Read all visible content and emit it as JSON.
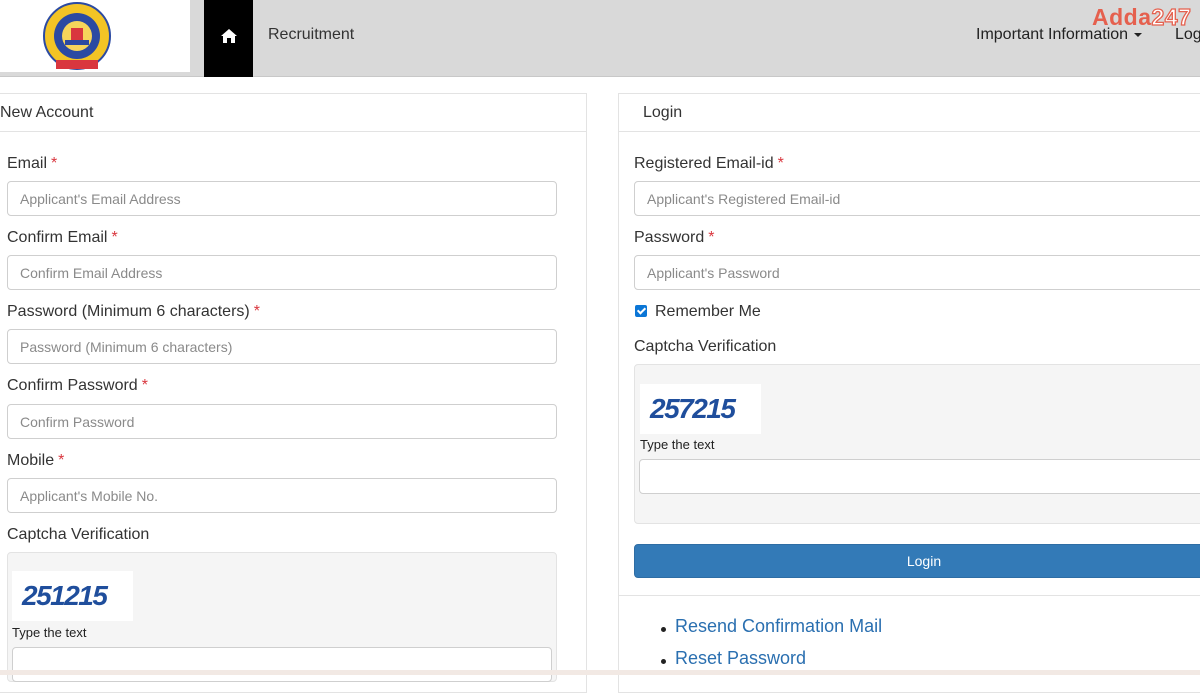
{
  "navbar": {
    "recruitment": "Recruitment",
    "important_info": "Important Information",
    "login_partial": "Log",
    "brand_word": "Adda",
    "brand_num": "247"
  },
  "new_account": {
    "heading": "New Account",
    "email_label": "Email",
    "email_placeholder": "Applicant's Email Address",
    "confirm_email_label": "Confirm Email",
    "confirm_email_placeholder": "Confirm Email Address",
    "password_label": "Password (Minimum 6 characters)",
    "password_placeholder": "Password (Minimum 6 characters)",
    "confirm_password_label": "Confirm Password",
    "confirm_password_placeholder": "Confirm Password",
    "mobile_label": "Mobile",
    "mobile_placeholder": "Applicant's Mobile No.",
    "captcha_label": "Captcha Verification",
    "captcha_code": "251215",
    "type_text": "Type the text",
    "required_mark": "*"
  },
  "login": {
    "heading": "Login",
    "email_label": "Registered Email-id",
    "email_placeholder": "Applicant's Registered Email-id",
    "password_label": "Password",
    "password_placeholder": "Applicant's Password",
    "remember_me": "Remember Me",
    "remember_checked": true,
    "captcha_label": "Captcha Verification",
    "captcha_code": "257215",
    "type_text": "Type the text",
    "login_button": "Login",
    "links": [
      "Resend Confirmation Mail",
      "Reset Password"
    ]
  },
  "colors": {
    "primary": "#337ab7",
    "link": "#2a6fb0",
    "required": "#d9363e",
    "brand": "#e5604e"
  },
  "icons": {
    "home": "home-icon",
    "caret": "caret-down-icon",
    "logo": "institute-logo"
  }
}
